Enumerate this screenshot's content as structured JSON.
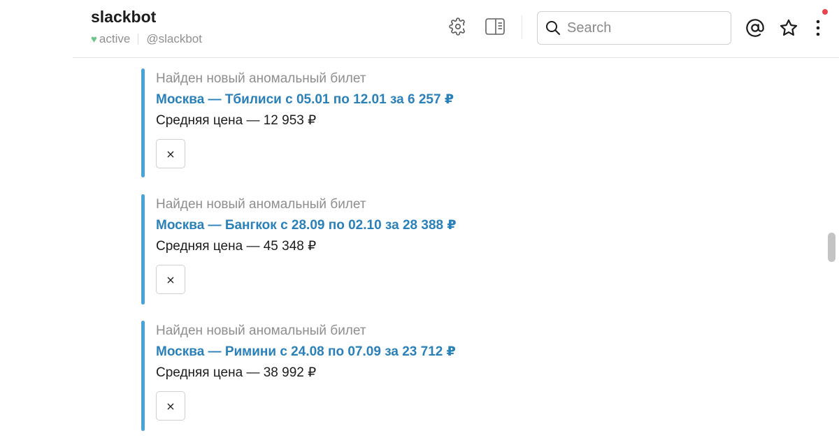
{
  "header": {
    "channel_name": "slackbot",
    "status": "active",
    "handle": "@slackbot",
    "search_placeholder": "Search",
    "icons": {
      "settings": "gear-icon",
      "details": "sidebar-toggle-icon",
      "search": "search-icon",
      "mentions": "at-sign-icon",
      "starred": "star-icon",
      "more": "more-vertical-icon"
    },
    "notification_color": "#e8454f"
  },
  "colors": {
    "attachment_bar": "#4aa3d6",
    "link": "#2a80b9",
    "status_active": "#6fc48c"
  },
  "messages": [
    {
      "pretext": "Найден новый аномальный билет",
      "title": "Москва — Тбилиси с 05.01 по 12.01 за 6 257 ₽",
      "text": "Средняя цена — 12 953 ₽",
      "dismiss_label": "×"
    },
    {
      "pretext": "Найден новый аномальный билет",
      "title": "Москва — Бангкок с 28.09 по 02.10 за 28 388 ₽",
      "text": "Средняя цена — 45 348 ₽",
      "dismiss_label": "×"
    },
    {
      "pretext": "Найден новый аномальный билет",
      "title": "Москва — Римини с 24.08 по 07.09 за 23 712 ₽",
      "text": "Средняя цена — 38 992 ₽",
      "dismiss_label": "×"
    }
  ]
}
